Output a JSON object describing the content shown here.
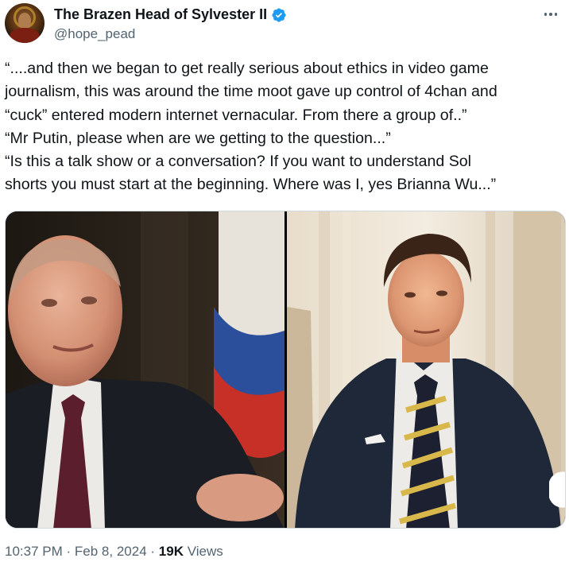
{
  "author": {
    "display_name": "The Brazen Head of Sylvester II",
    "handle": "@hope_pead",
    "verified": true,
    "avatar_icon": "avatar-portrait"
  },
  "tweet": {
    "lines": [
      "“....and then we began to get really serious about ethics in video game",
      "journalism, this was around the time moot gave up control of 4chan and",
      "“cuck” entered modern internet vernacular. From there a group of..”",
      "“Mr Putin, please when are we getting to the question...”",
      "“Is this a talk show or a conversation? If you want to understand Sol",
      "shorts you must start at the beginning. Where was I, yes Brianna Wu...”"
    ]
  },
  "media": {
    "left_alt": "Interview still: man in dark suit and maroon tie, flag in background",
    "right_alt": "Interview still: man in navy suit with striped tie, curtains in background"
  },
  "meta": {
    "time": "10:37 PM",
    "separator": "·",
    "date": "Feb 8, 2024",
    "views_count": "19K",
    "views_label": "Views"
  },
  "colors": {
    "text_primary": "#0f1419",
    "text_secondary": "#536471",
    "verified_blue": "#1d9bf0"
  }
}
